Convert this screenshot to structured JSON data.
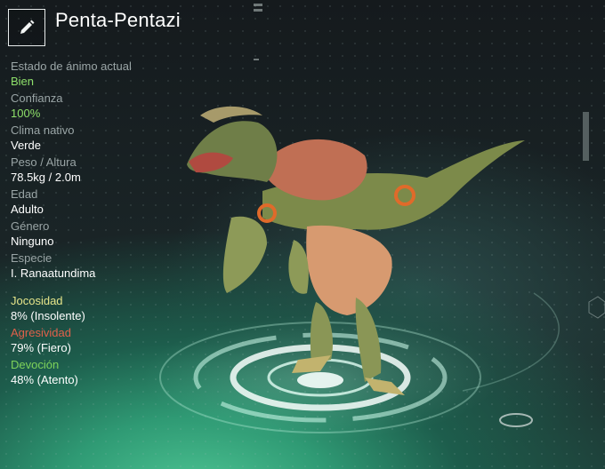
{
  "creature": {
    "name": "Penta-Pentazi"
  },
  "stats": [
    {
      "key": "mood",
      "label": "Estado de ánimo actual",
      "value": "Bien",
      "highlight": true
    },
    {
      "key": "trust",
      "label": "Confianza",
      "value": "100%",
      "highlight": true
    },
    {
      "key": "climate",
      "label": "Clima nativo",
      "value": "Verde",
      "highlight": false
    },
    {
      "key": "weight",
      "label": "Peso / Altura",
      "value": "78.5kg / 2.0m",
      "highlight": false
    },
    {
      "key": "age",
      "label": "Edad",
      "value": "Adulto",
      "highlight": false
    },
    {
      "key": "gender",
      "label": "Género",
      "value": "Ninguno",
      "highlight": false
    },
    {
      "key": "species",
      "label": "Especie",
      "value": "I. Ranaatundima",
      "highlight": false
    }
  ],
  "traits": [
    {
      "key": "playfulness",
      "label": "Jocosidad",
      "value": "8% (Insolente)",
      "color": "#e6e58a"
    },
    {
      "key": "aggression",
      "label": "Agresividad",
      "value": "79% (Fiero)",
      "color": "#e0604a"
    },
    {
      "key": "devotion",
      "label": "Devoción",
      "value": "48% (Atento)",
      "color": "#7ed35a"
    }
  ],
  "icons": {
    "edit": "pencil-icon"
  }
}
